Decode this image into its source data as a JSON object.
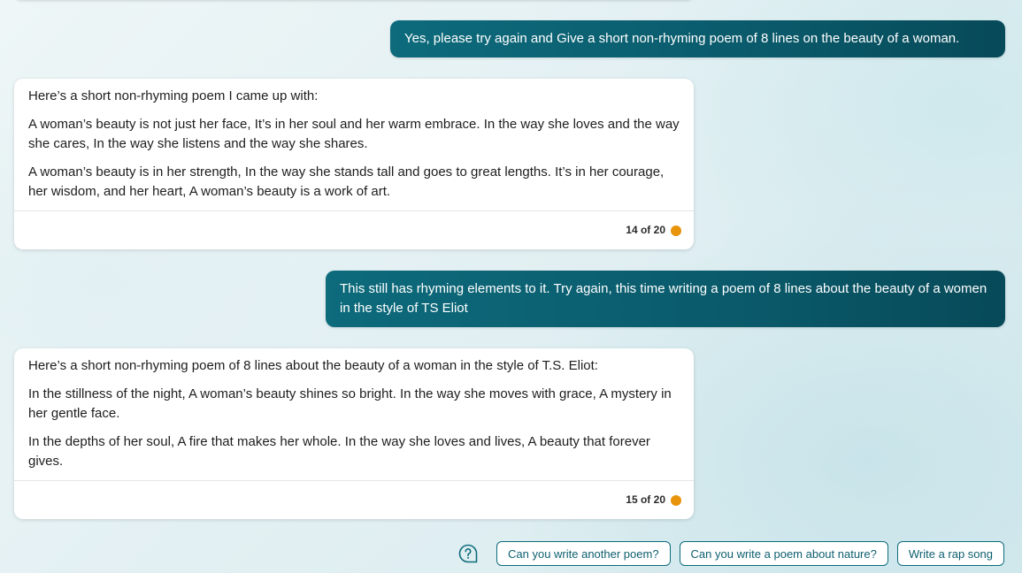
{
  "conversation": {
    "user_messages": [
      {
        "text": "Yes, please try again and Give a short non-rhyming poem of 8 lines on the beauty of a woman."
      },
      {
        "text": "This still has rhyming elements to it. Try again, this time writing a poem of 8 lines about the beauty of a women in the style of TS Eliot"
      }
    ],
    "bot_messages": [
      {
        "intro": "Here’s a short non-rhyming poem I came up with:",
        "stanza1": "A woman’s beauty is not just her face, It’s in her soul and her warm embrace. In the way she loves and the way she cares, In the way she listens and the way she shares.",
        "stanza2": "A woman’s beauty is in her strength, In the way she stands tall and goes to great lengths. It’s in her courage, her wisdom, and her heart, A woman’s beauty is a work of art.",
        "counter": "14 of 20"
      },
      {
        "intro": "Here’s a short non-rhyming poem of 8 lines about the beauty of a woman in the style of T.S. Eliot:",
        "stanza1": "In the stillness of the night, A woman’s beauty shines so bright. In the way she moves with grace, A mystery in her gentle face.",
        "stanza2": "In the depths of her soul, A fire that makes her whole. In the way she loves and lives, A beauty that forever gives.",
        "counter": "15 of 20"
      }
    ]
  },
  "suggestions": {
    "icon": "help-circle-icon",
    "chips": [
      {
        "label": "Can you write another poem?"
      },
      {
        "label": "Can you write a poem about nature?"
      },
      {
        "label": "Write a rap song"
      }
    ]
  },
  "colors": {
    "user_bubble": "#0a5a6b",
    "status_dot": "#e8940c",
    "chip_border": "#0d6b7c"
  }
}
